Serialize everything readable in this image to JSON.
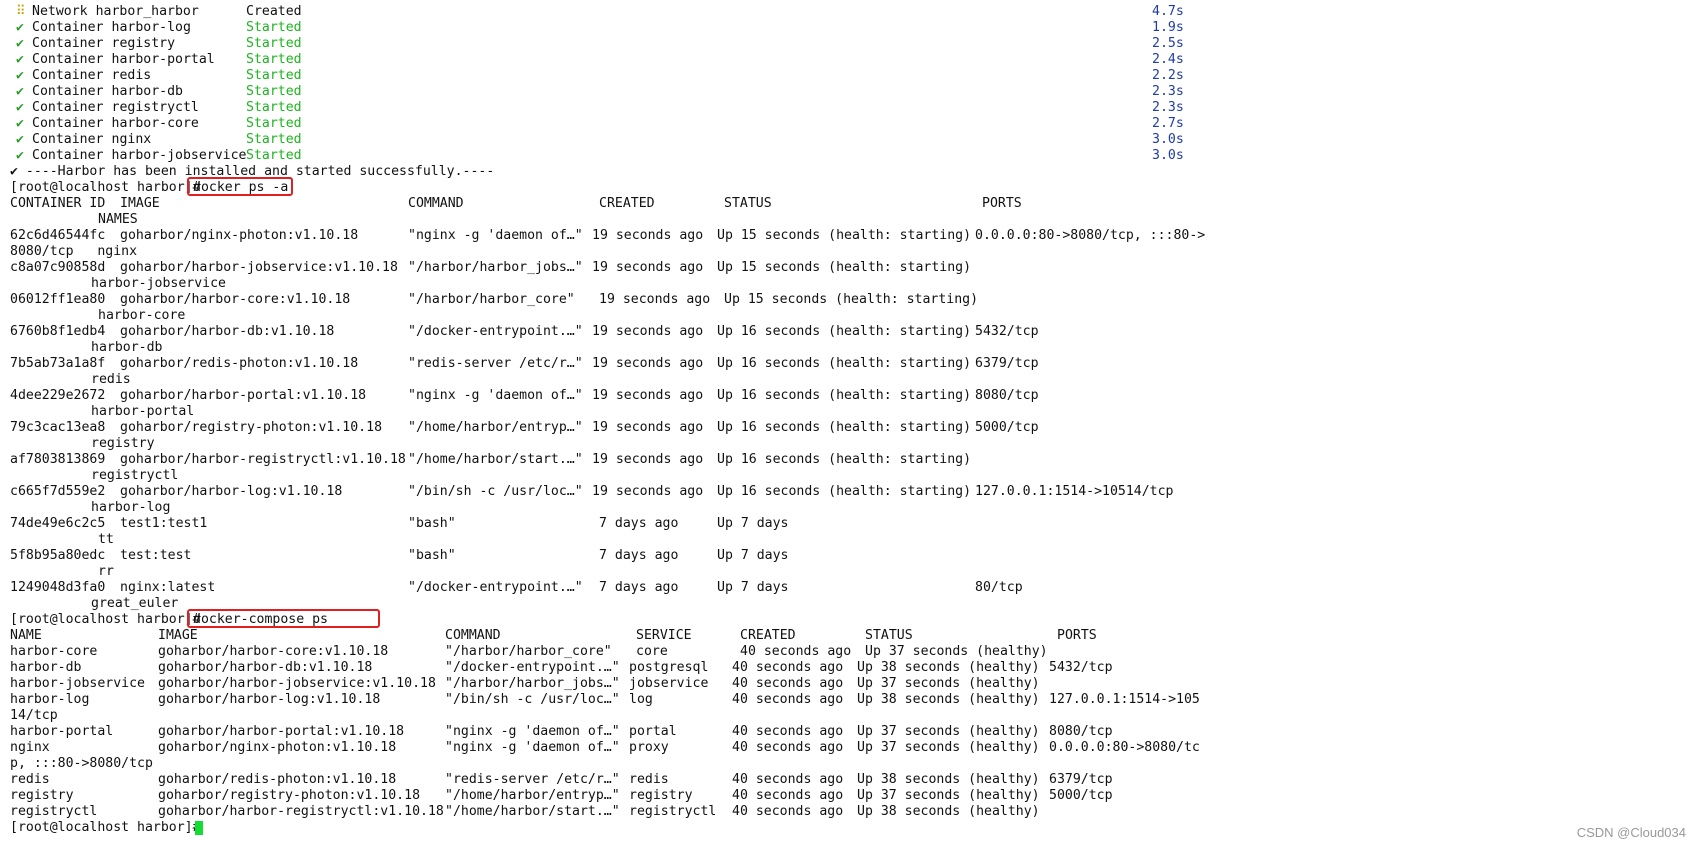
{
  "install_log": [
    {
      "marker": "⠿",
      "kind": "pending",
      "type": "Network",
      "name": "harbor_harbor",
      "status": "Created",
      "time": "4.7s"
    },
    {
      "marker": "✔",
      "kind": "done",
      "type": "Container",
      "name": "harbor-log",
      "status": "Started",
      "time": "1.9s"
    },
    {
      "marker": "✔",
      "kind": "done",
      "type": "Container",
      "name": "registry",
      "status": "Started",
      "time": "2.5s"
    },
    {
      "marker": "✔",
      "kind": "done",
      "type": "Container",
      "name": "harbor-portal",
      "status": "Started",
      "time": "2.4s"
    },
    {
      "marker": "✔",
      "kind": "done",
      "type": "Container",
      "name": "redis",
      "status": "Started",
      "time": "2.2s"
    },
    {
      "marker": "✔",
      "kind": "done",
      "type": "Container",
      "name": "harbor-db",
      "status": "Started",
      "time": "2.3s"
    },
    {
      "marker": "✔",
      "kind": "done",
      "type": "Container",
      "name": "registryctl",
      "status": "Started",
      "time": "2.3s"
    },
    {
      "marker": "✔",
      "kind": "done",
      "type": "Container",
      "name": "harbor-core",
      "status": "Started",
      "time": "2.7s"
    },
    {
      "marker": "✔",
      "kind": "done",
      "type": "Container",
      "name": "nginx",
      "status": "Started",
      "time": "3.0s"
    },
    {
      "marker": "✔",
      "kind": "done",
      "type": "Container",
      "name": "harbor-jobservice",
      "status": "Started",
      "time": "3.0s"
    }
  ],
  "install_done": "✔ ----Harbor has been installed and started successfully.----",
  "prompt": "[root@localhost harbor]#",
  "cmd1": "docker ps -a",
  "docker_ps": {
    "headers": {
      "id": "CONTAINER ID",
      "image": "IMAGE",
      "command": "COMMAND",
      "created": "CREATED",
      "status": "STATUS",
      "ports": "PORTS",
      "names": "NAMES"
    },
    "rows": [
      {
        "id": "62c6d46544fc",
        "image": "goharbor/nginx-photon:v1.10.18",
        "command": "\"nginx -g 'daemon of…\"",
        "created": "19 seconds ago",
        "status": "Up 15 seconds (health: starting)",
        "ports": "0.0.0.0:80->8080/tcp, :::80->",
        "wrap": "8080/tcp   nginx"
      },
      {
        "id": "c8a07c90858d",
        "image": "goharbor/harbor-jobservice:v1.10.18",
        "command": "\"/harbor/harbor_jobs…\"",
        "created": "19 seconds ago",
        "status": "Up 15 seconds (health: starting)",
        "ports": "",
        "wrap": "harbor-jobservice"
      },
      {
        "id": "06012ff1ea80",
        "image": "goharbor/harbor-core:v1.10.18",
        "command": "\"/harbor/harbor_core\"",
        "created": "19 seconds ago",
        "status": "Up 15 seconds (health: starting)",
        "ports": "",
        "wrap": "harbor-core"
      },
      {
        "id": "6760b8f1edb4",
        "image": "goharbor/harbor-db:v1.10.18",
        "command": "\"/docker-entrypoint.…\"",
        "created": "19 seconds ago",
        "status": "Up 16 seconds (health: starting)",
        "ports": "5432/tcp",
        "wrap": "harbor-db"
      },
      {
        "id": "7b5ab73a1a8f",
        "image": "goharbor/redis-photon:v1.10.18",
        "command": "\"redis-server /etc/r…\"",
        "created": "19 seconds ago",
        "status": "Up 16 seconds (health: starting)",
        "ports": "6379/tcp",
        "wrap": "redis"
      },
      {
        "id": "4dee229e2672",
        "image": "goharbor/harbor-portal:v1.10.18",
        "command": "\"nginx -g 'daemon of…\"",
        "created": "19 seconds ago",
        "status": "Up 16 seconds (health: starting)",
        "ports": "8080/tcp",
        "wrap": "harbor-portal"
      },
      {
        "id": "79c3cac13ea8",
        "image": "goharbor/registry-photon:v1.10.18",
        "command": "\"/home/harbor/entryp…\"",
        "created": "19 seconds ago",
        "status": "Up 16 seconds (health: starting)",
        "ports": "5000/tcp",
        "wrap": "registry"
      },
      {
        "id": "af7803813869",
        "image": "goharbor/harbor-registryctl:v1.10.18",
        "command": "\"/home/harbor/start.…\"",
        "created": "19 seconds ago",
        "status": "Up 16 seconds (health: starting)",
        "ports": "",
        "wrap": "registryctl"
      },
      {
        "id": "c665f7d559e2",
        "image": "goharbor/harbor-log:v1.10.18",
        "command": "\"/bin/sh -c /usr/loc…\"",
        "created": "19 seconds ago",
        "status": "Up 16 seconds (health: starting)",
        "ports": "127.0.0.1:1514->10514/tcp",
        "wrap": "harbor-log"
      },
      {
        "id": "74de49e6c2c5",
        "image": "test1:test1",
        "command": "\"bash\"",
        "created": "7 days ago",
        "status": "Up 7 days",
        "ports": "",
        "wrap": "tt"
      },
      {
        "id": "5f8b95a80edc",
        "image": "test:test",
        "command": "\"bash\"",
        "created": "7 days ago",
        "status": "Up 7 days",
        "ports": "",
        "wrap": "rr"
      },
      {
        "id": "1249048d3fa0",
        "image": "nginx:latest",
        "command": "\"/docker-entrypoint.…\"",
        "created": "7 days ago",
        "status": "Up 7 days",
        "ports": "80/tcp",
        "wrap": "great_euler"
      }
    ]
  },
  "cmd2": "docker-compose ps",
  "compose_ps": {
    "headers": {
      "name": "NAME",
      "image": "IMAGE",
      "command": "COMMAND",
      "service": "SERVICE",
      "created": "CREATED",
      "status": "STATUS",
      "ports": "PORTS"
    },
    "rows": [
      {
        "name": "harbor-core",
        "image": "goharbor/harbor-core:v1.10.18",
        "command": "\"/harbor/harbor_core\"",
        "service": "core",
        "created": "40 seconds ago",
        "status": "Up 37 seconds (healthy)",
        "ports": "",
        "wrap": ""
      },
      {
        "name": "harbor-db",
        "image": "goharbor/harbor-db:v1.10.18",
        "command": "\"/docker-entrypoint.…\"",
        "service": "postgresql",
        "created": "40 seconds ago",
        "status": "Up 38 seconds (healthy)",
        "ports": "5432/tcp",
        "wrap": ""
      },
      {
        "name": "harbor-jobservice",
        "image": "goharbor/harbor-jobservice:v1.10.18",
        "command": "\"/harbor/harbor_jobs…\"",
        "service": "jobservice",
        "created": "40 seconds ago",
        "status": "Up 37 seconds (healthy)",
        "ports": "",
        "wrap": ""
      },
      {
        "name": "harbor-log",
        "image": "goharbor/harbor-log:v1.10.18",
        "command": "\"/bin/sh -c /usr/loc…\"",
        "service": "log",
        "created": "40 seconds ago",
        "status": "Up 38 seconds (healthy)",
        "ports": "127.0.0.1:1514->105",
        "wrap": "14/tcp"
      },
      {
        "name": "harbor-portal",
        "image": "goharbor/harbor-portal:v1.10.18",
        "command": "\"nginx -g 'daemon of…\"",
        "service": "portal",
        "created": "40 seconds ago",
        "status": "Up 37 seconds (healthy)",
        "ports": "8080/tcp",
        "wrap": ""
      },
      {
        "name": "nginx",
        "image": "goharbor/nginx-photon:v1.10.18",
        "command": "\"nginx -g 'daemon of…\"",
        "service": "proxy",
        "created": "40 seconds ago",
        "status": "Up 37 seconds (healthy)",
        "ports": "0.0.0.0:80->8080/tc",
        "wrap": "p, :::80->8080/tcp"
      },
      {
        "name": "redis",
        "image": "goharbor/redis-photon:v1.10.18",
        "command": "\"redis-server /etc/r…\"",
        "service": "redis",
        "created": "40 seconds ago",
        "status": "Up 38 seconds (healthy)",
        "ports": "6379/tcp",
        "wrap": ""
      },
      {
        "name": "registry",
        "image": "goharbor/registry-photon:v1.10.18",
        "command": "\"/home/harbor/entryp…\"",
        "service": "registry",
        "created": "40 seconds ago",
        "status": "Up 37 seconds (healthy)",
        "ports": "5000/tcp",
        "wrap": ""
      },
      {
        "name": "registryctl",
        "image": "goharbor/harbor-registryctl:v1.10.18",
        "command": "\"/home/harbor/start.…\"",
        "service": "registryctl",
        "created": "40 seconds ago",
        "status": "Up 38 seconds (healthy)",
        "ports": "",
        "wrap": ""
      }
    ]
  },
  "watermark": "CSDN @Cloud034",
  "colors": {
    "check": "#2a9d2a",
    "pending": "#c8a000",
    "started": "#1eb41e",
    "time": "#1f3ba8",
    "highlight_box": "#e02020",
    "cursor": "#11dd33"
  }
}
